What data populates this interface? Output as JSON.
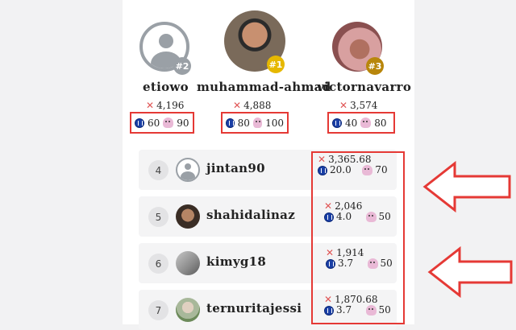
{
  "podium": [
    {
      "name": "etiowo",
      "rank_badge": "#2",
      "score": "4,196",
      "coin": "60",
      "octo": "90"
    },
    {
      "name": "muhammad-ahmad",
      "rank_badge": "#1",
      "score": "4,888",
      "coin": "80",
      "octo": "100"
    },
    {
      "name": "victornavarro",
      "rank_badge": "#3",
      "score": "3,574",
      "coin": "40",
      "octo": "80"
    }
  ],
  "rows": [
    {
      "rank": "4",
      "name": "jintan90",
      "score": "3,365.68",
      "coin": "20.0",
      "octo": "70"
    },
    {
      "rank": "5",
      "name": "shahidalinaz",
      "score": "2,046",
      "coin": "4.0",
      "octo": "50"
    },
    {
      "rank": "6",
      "name": "kimyg18",
      "score": "1,914",
      "coin": "3.7",
      "octo": "50"
    },
    {
      "rank": "7",
      "name": "ternuritajessi",
      "score": "1,870.68",
      "coin": "3.7",
      "octo": "50"
    }
  ],
  "colors": {
    "highlight": "#e53935",
    "gold": "#e6b800",
    "silver": "#9aa0a6",
    "bronze": "#b8860b"
  }
}
